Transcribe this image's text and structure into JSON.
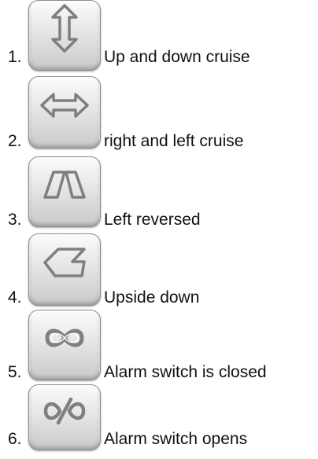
{
  "items": [
    {
      "number": "1.",
      "label": "Up and down cruise",
      "icon": "vertical-double-arrow-icon"
    },
    {
      "number": "2.",
      "label": "right and left cruise",
      "icon": "horizontal-double-arrow-icon"
    },
    {
      "number": "3.",
      "label": "Left reversed",
      "icon": "trapezoid-flip-icon"
    },
    {
      "number": "4.",
      "label": "Upside down",
      "icon": "chevron-left-flag-icon"
    },
    {
      "number": "5.",
      "label": "Alarm switch is closed",
      "icon": "infinity-loop-icon"
    },
    {
      "number": "6.",
      "label": "Alarm switch opens",
      "icon": "split-loop-icon"
    }
  ],
  "colors": {
    "icon_stroke": "#7f7f7f",
    "button_border": "#8c8c8c"
  }
}
